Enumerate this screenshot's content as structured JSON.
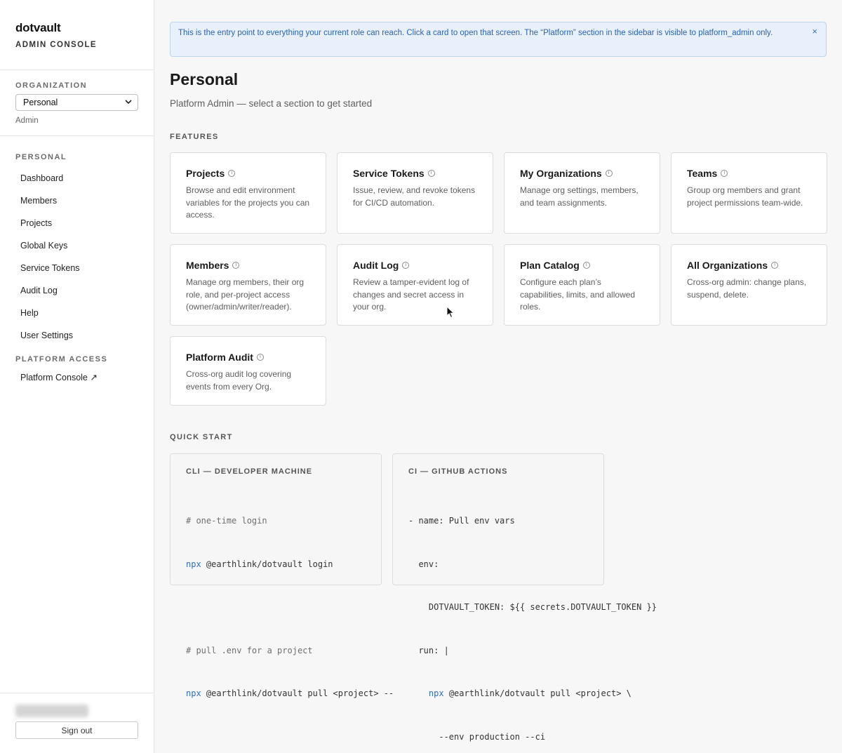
{
  "sidebar": {
    "brand_name": "dotvault",
    "brand_sub": "ADMIN CONSOLE",
    "org_label": "ORGANIZATION",
    "org_selected": "Personal",
    "org_role": "Admin",
    "personal_label": "PERSONAL",
    "items": [
      {
        "label": "Dashboard"
      },
      {
        "label": "Members"
      },
      {
        "label": "Projects"
      },
      {
        "label": "Global Keys"
      },
      {
        "label": "Service Tokens"
      },
      {
        "label": "Audit Log"
      },
      {
        "label": "Help"
      },
      {
        "label": "User Settings"
      }
    ],
    "platform_label": "PLATFORM ACCESS",
    "platform_item": "Platform Console ↗",
    "sign_out": "Sign out"
  },
  "banner": {
    "text": "This is the entry point to everything your current role can reach. Click a card to open that screen. The “Platform” section in the sidebar is visible to platform_admin only.",
    "close": "×"
  },
  "main": {
    "title": "Personal",
    "subtitle": "Platform Admin — select a section to get started",
    "features_label": "FEATURES",
    "info_glyph": "i",
    "cards": [
      {
        "title": "Projects",
        "desc": "Browse and edit environment variables for the projects you can access."
      },
      {
        "title": "Service Tokens",
        "desc": "Issue, review, and revoke tokens for CI/CD automation."
      },
      {
        "title": "My Organizations",
        "desc": "Manage org settings, members, and team assignments."
      },
      {
        "title": "Teams",
        "desc": "Group org members and grant project permissions team-wide."
      },
      {
        "title": "Members",
        "desc": "Manage org members, their org role, and per-project access (owner/admin/writer/reader)."
      },
      {
        "title": "Audit Log",
        "desc": "Review a tamper-evident log of changes and secret access in your org."
      },
      {
        "title": "Plan Catalog",
        "desc": "Configure each plan’s capabilities, limits, and allowed roles."
      },
      {
        "title": "All Organizations",
        "desc": "Cross-org admin: change plans, suspend, delete."
      },
      {
        "title": "Platform Audit",
        "desc": "Cross-org audit log covering events from every Org."
      }
    ],
    "quickstart_label": "QUICK START",
    "cli": {
      "title": "CLI — DEVELOPER MACHINE",
      "l1": "# one-time login",
      "l2_kw": "npx",
      "l2_rest": " @earthlink/dotvault login",
      "l3": "# pull .env for a project",
      "l4_kw": "npx",
      "l4_rest": " @earthlink/dotvault pull <project> --"
    },
    "ci": {
      "title": "CI — GITHUB ACTIONS",
      "l1": "- name: Pull env vars",
      "l2": "  env:",
      "l3": "    DOTVAULT_TOKEN: ${{ secrets.DOTVAULT_TOKEN }}",
      "l4": "  run: |",
      "l5_indent": "    ",
      "l5_kw": "npx",
      "l5_rest": " @earthlink/dotvault pull <project> \\",
      "l6": "      --env production --ci"
    }
  }
}
